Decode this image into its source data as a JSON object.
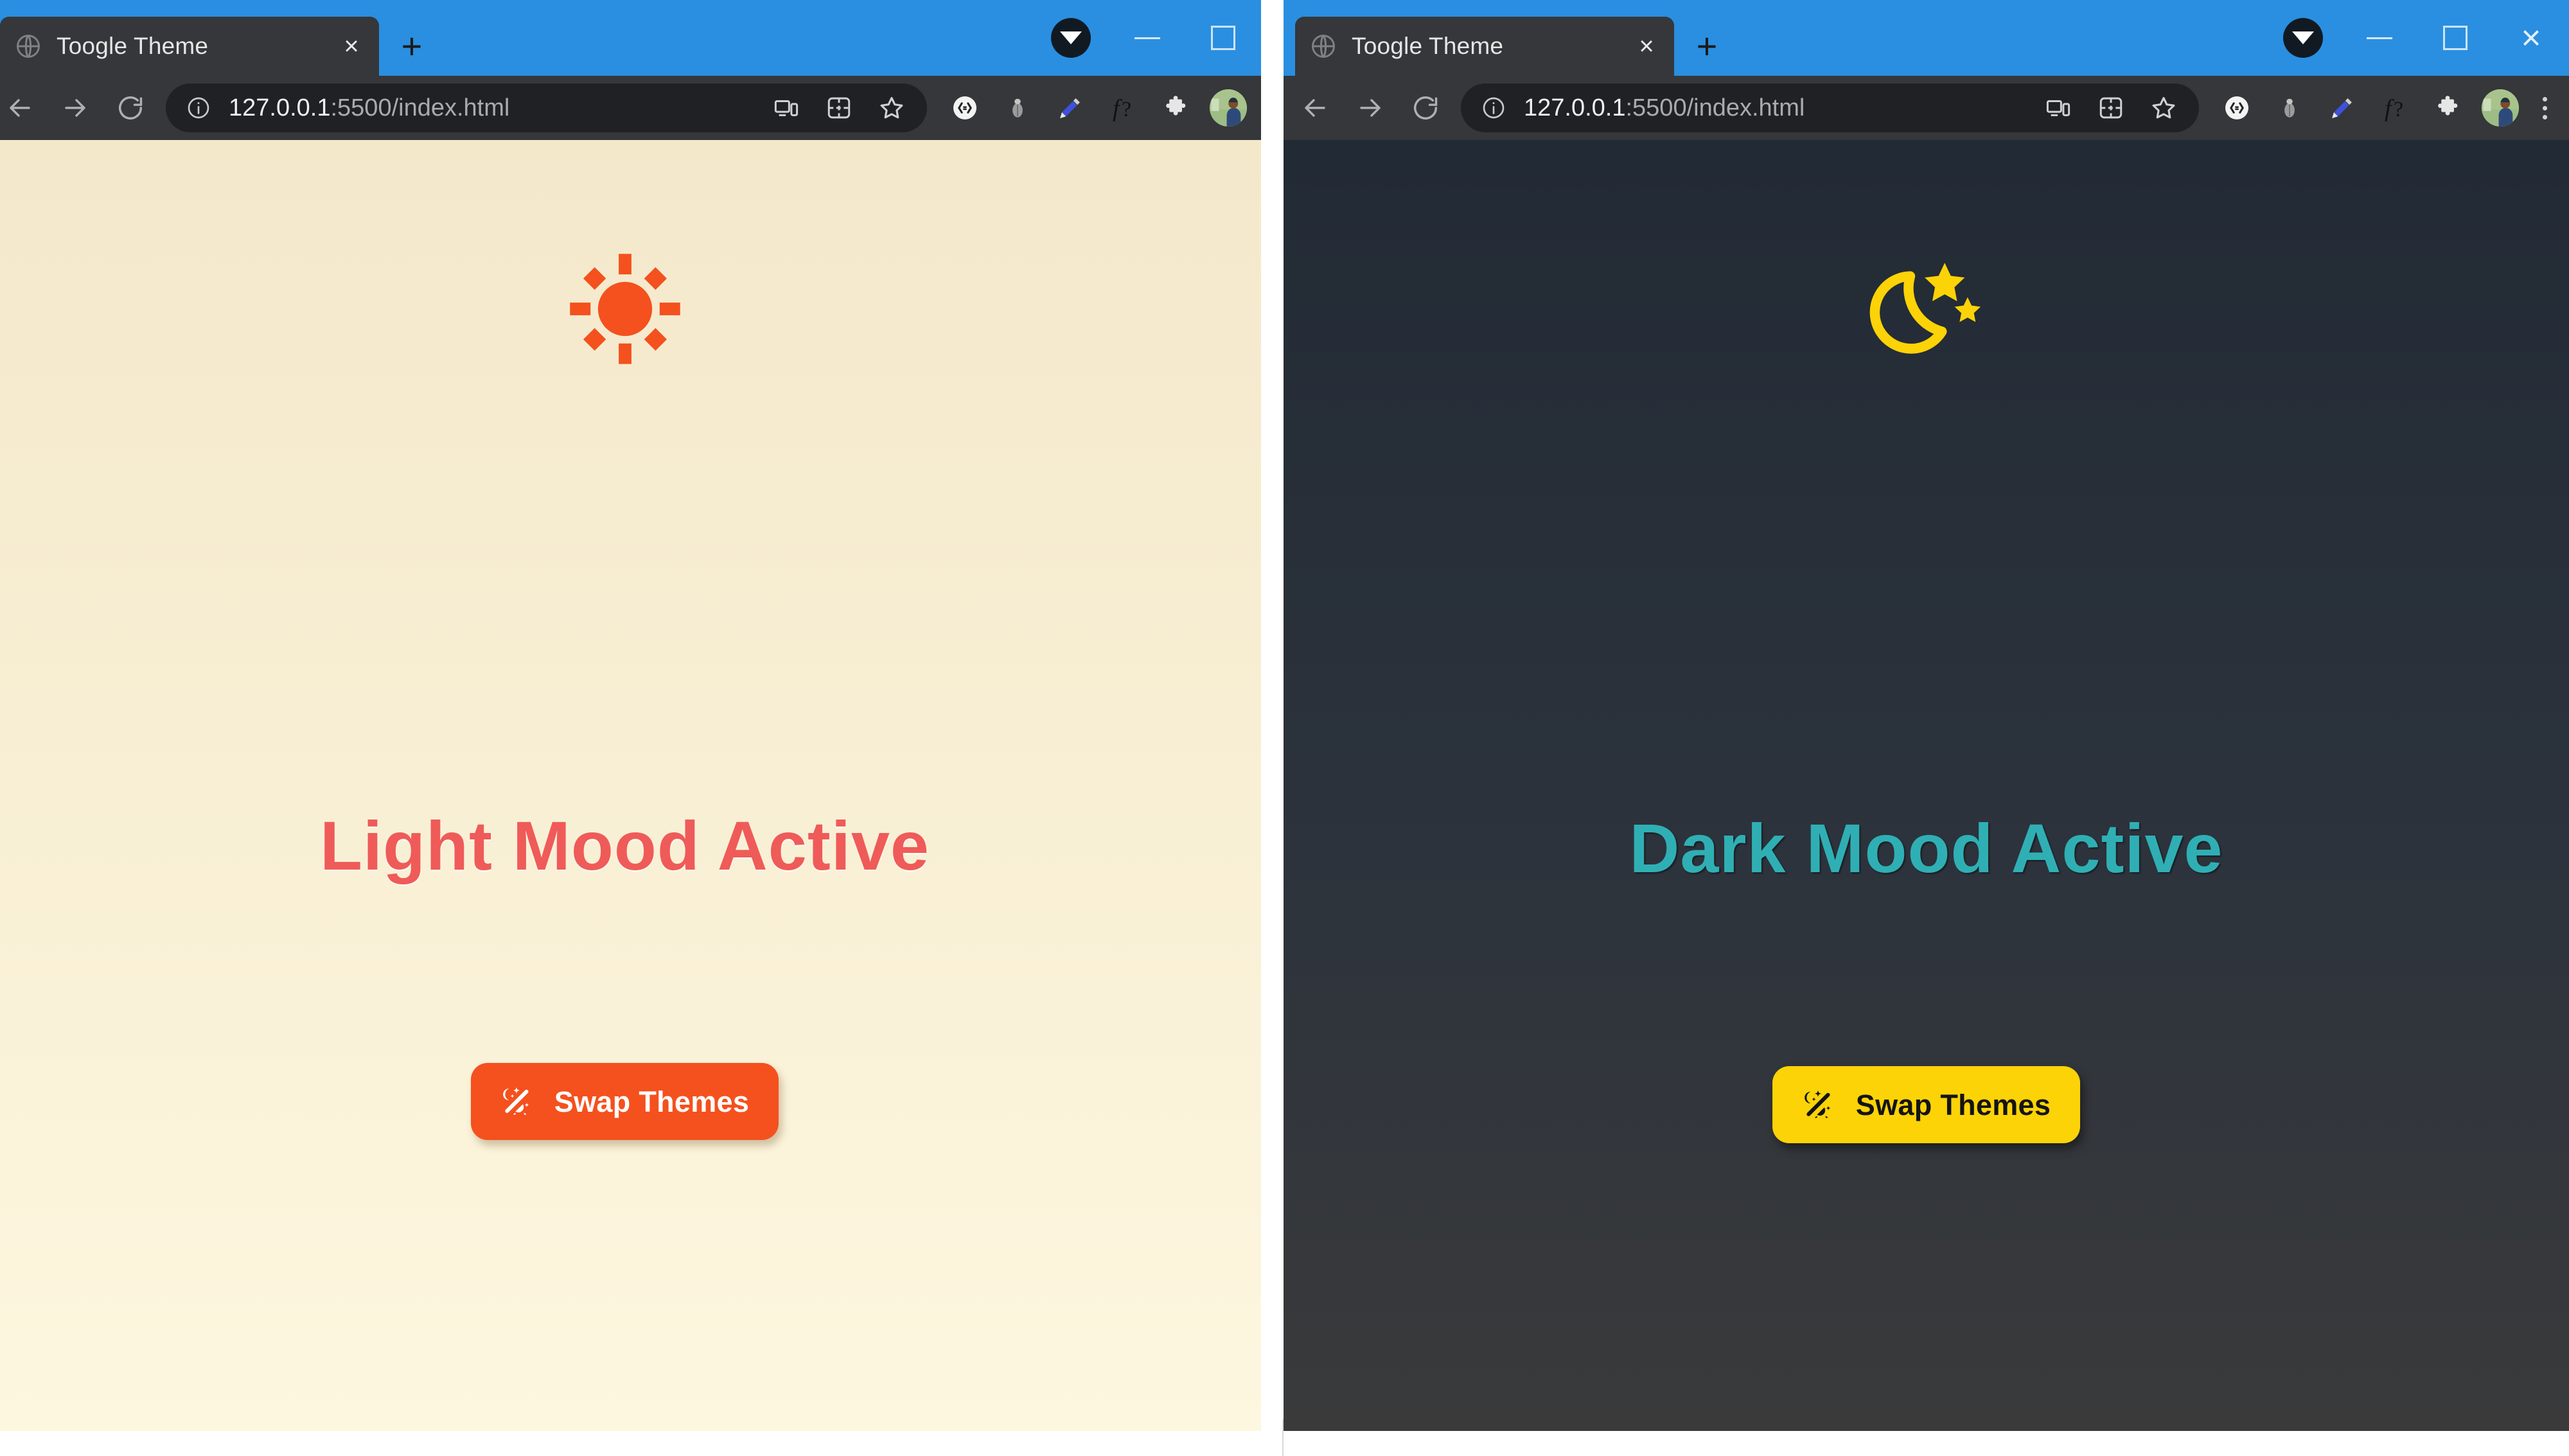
{
  "windows": [
    {
      "id": "light-window",
      "theme": "light",
      "tab": {
        "title": "Toogle Theme",
        "favicon": "globe-icon",
        "close_label": "×",
        "newtab_label": "+"
      },
      "window_controls": {
        "dropdown": "chevron-down-icon",
        "minimize": "minimize-icon",
        "maximize": "maximize-icon",
        "close": "×",
        "close_visible": false,
        "kebab_visible": false
      },
      "toolbar": {
        "back": "back-arrow-icon",
        "forward": "forward-arrow-icon",
        "reload": "reload-icon",
        "site_info": "info-circle-icon",
        "url_host": "127.0.0.1",
        "url_path": ":5500/index.html",
        "url_full": "127.0.0.1:5500/index.html",
        "omnibox_icons": [
          "cast-device-icon",
          "split-grid-icon",
          "bookmark-star-icon"
        ],
        "extension_icons": [
          "code-brackets-icon",
          "bug-icon",
          "eyedropper-pen-icon",
          "font-question-icon",
          "puzzle-extensions-icon"
        ],
        "avatar": "profile-avatar-icon",
        "kebab": "kebab-menu-icon"
      },
      "page": {
        "theme_icon": "sun-icon",
        "heading": "Light Mood Active",
        "button_label": "Swap Themes",
        "button_icon": "magic-wand-icon",
        "colors": {
          "bg_top": "#F4E8CB",
          "bg_bottom": "#FDF7DF",
          "icon": "#F4511E",
          "heading": "#EF5B58",
          "button_bg": "#F4511E",
          "button_text": "#FFFFFF"
        }
      }
    },
    {
      "id": "dark-window",
      "theme": "dark",
      "tab": {
        "title": "Toogle Theme",
        "favicon": "globe-icon",
        "close_label": "×",
        "newtab_label": "+"
      },
      "window_controls": {
        "dropdown": "chevron-down-icon",
        "minimize": "minimize-icon",
        "maximize": "maximize-icon",
        "close": "×",
        "close_visible": true,
        "kebab_visible": true
      },
      "toolbar": {
        "back": "back-arrow-icon",
        "forward": "forward-arrow-icon",
        "reload": "reload-icon",
        "site_info": "info-circle-icon",
        "url_host": "127.0.0.1",
        "url_path": ":5500/index.html",
        "url_full": "127.0.0.1:5500/index.html",
        "omnibox_icons": [
          "cast-device-icon",
          "split-grid-icon",
          "bookmark-star-icon"
        ],
        "extension_icons": [
          "code-brackets-icon",
          "bug-icon",
          "eyedropper-pen-icon",
          "font-question-icon",
          "puzzle-extensions-icon"
        ],
        "avatar": "profile-avatar-icon",
        "kebab": "kebab-menu-icon"
      },
      "page": {
        "theme_icon": "moon-stars-icon",
        "heading": "Dark Mood Active",
        "button_label": "Swap Themes",
        "button_icon": "magic-wand-icon",
        "colors": {
          "bg_top": "#222A35",
          "bg_bottom": "#3A3A3B",
          "icon": "#FCD307",
          "heading": "#2FAFB4",
          "button_bg": "#FCD307",
          "button_text": "#141414"
        }
      }
    }
  ],
  "browser_chrome": {
    "titlebar_color": "#2A8FE0",
    "tabstrip_color": "#35373A",
    "omnibox_color": "#202124"
  }
}
